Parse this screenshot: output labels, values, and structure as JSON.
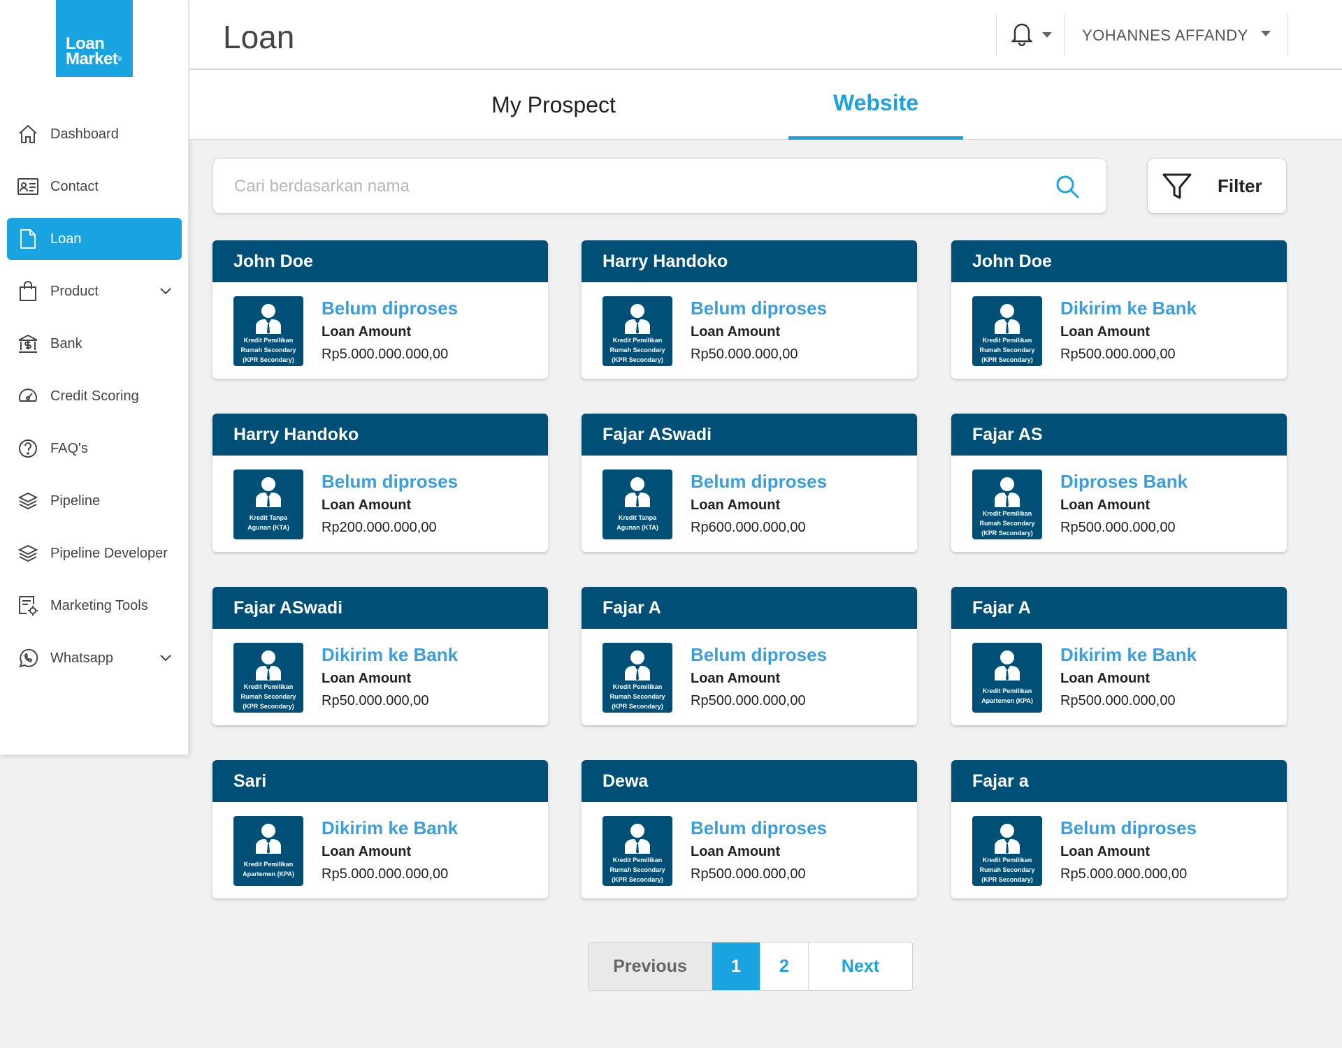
{
  "brand": {
    "line1": "Loan",
    "line2": "Market",
    "mark": "®",
    "color": "#1aa3e1"
  },
  "sidebar": {
    "items": [
      {
        "label": "Dashboard",
        "icon": "home-icon",
        "active": false
      },
      {
        "label": "Contact",
        "icon": "contact-card-icon",
        "active": false
      },
      {
        "label": "Loan",
        "icon": "document-icon",
        "active": true
      },
      {
        "label": "Product",
        "icon": "shopping-bag-icon",
        "active": false,
        "expandable": true
      },
      {
        "label": "Bank",
        "icon": "bank-icon",
        "active": false
      },
      {
        "label": "Credit Scoring",
        "icon": "gauge-icon",
        "active": false
      },
      {
        "label": "FAQ's",
        "icon": "question-icon",
        "active": false
      },
      {
        "label": "Pipeline",
        "icon": "layers-icon",
        "active": false
      },
      {
        "label": "Pipeline Developer",
        "icon": "layers-icon",
        "active": false
      },
      {
        "label": "Marketing Tools",
        "icon": "settings-doc-icon",
        "active": false
      },
      {
        "label": "Whatsapp",
        "icon": "whatsapp-icon",
        "active": false,
        "expandable": true
      }
    ]
  },
  "header": {
    "title": "Loan",
    "user_name": "YOHANNES AFFANDY"
  },
  "tabs": [
    {
      "label": "My Prospect",
      "active": false
    },
    {
      "label": "Website",
      "active": true
    }
  ],
  "search": {
    "placeholder": "Cari berdasarkan nama",
    "value": ""
  },
  "filter": {
    "label": "Filter"
  },
  "amount_label": "Loan Amount",
  "cards": [
    {
      "name": "John Doe",
      "status": "Belum diproses",
      "amount": "Rp5.000.000.000,00",
      "product": [
        "Kredit Pemilikan",
        "Rumah Secondary",
        "(KPR Secondary)"
      ]
    },
    {
      "name": "Harry Handoko",
      "status": "Belum diproses",
      "amount": "Rp50.000.000,00",
      "product": [
        "Kredit Pemilikan",
        "Rumah Secondary",
        "(KPR Secondary)"
      ]
    },
    {
      "name": "John Doe",
      "status": "Dikirim ke Bank",
      "amount": "Rp500.000.000,00",
      "product": [
        "Kredit Pemilikan",
        "Rumah Secondary",
        "(KPR Secondary)"
      ]
    },
    {
      "name": "Harry Handoko",
      "status": "Belum diproses",
      "amount": "Rp200.000.000,00",
      "product": [
        "Kredit Tanpa",
        "Agunan (KTA)"
      ]
    },
    {
      "name": "Fajar ASwadi",
      "status": "Belum diproses",
      "amount": "Rp600.000.000,00",
      "product": [
        "Kredit Tanpa",
        "Agunan (KTA)"
      ]
    },
    {
      "name": "Fajar AS",
      "status": "Diproses Bank",
      "amount": "Rp500.000.000,00",
      "product": [
        "Kredit Pemilikan",
        "Rumah Secondary",
        "(KPR Secondary)"
      ]
    },
    {
      "name": "Fajar ASwadi",
      "status": "Dikirim ke Bank",
      "amount": "Rp50.000.000,00",
      "product": [
        "Kredit Pemilikan",
        "Rumah Secondary",
        "(KPR Secondary)"
      ]
    },
    {
      "name": "Fajar A",
      "status": "Belum diproses",
      "amount": "Rp500.000.000,00",
      "product": [
        "Kredit Pemilikan",
        "Rumah Secondary",
        "(KPR Secondary)"
      ]
    },
    {
      "name": "Fajar A",
      "status": "Dikirim ke Bank",
      "amount": "Rp500.000.000,00",
      "product": [
        "Kredit Pemilikan",
        "Apartemen (KPA)"
      ]
    },
    {
      "name": "Sari",
      "status": "Dikirim ke Bank",
      "amount": "Rp5.000.000.000,00",
      "product": [
        "Kredit Pemilikan",
        "Apartemen (KPA)"
      ]
    },
    {
      "name": "Dewa",
      "status": "Belum diproses",
      "amount": "Rp500.000.000,00",
      "product": [
        "Kredit Pemilikan",
        "Rumah Secondary",
        "(KPR Secondary)"
      ]
    },
    {
      "name": "Fajar a",
      "status": "Belum diproses",
      "amount": "Rp5.000.000.000,00",
      "product": [
        "Kredit Pemilikan",
        "Rumah Secondary",
        "(KPR Secondary)"
      ]
    }
  ],
  "pagination": {
    "previous": "Previous",
    "pages": [
      "1",
      "2"
    ],
    "current": "1",
    "next": "Next"
  },
  "colors": {
    "accent": "#1aa3e1",
    "card_header": "#004f76",
    "status_text": "#3a9fdc",
    "background": "#f1f1f1"
  }
}
